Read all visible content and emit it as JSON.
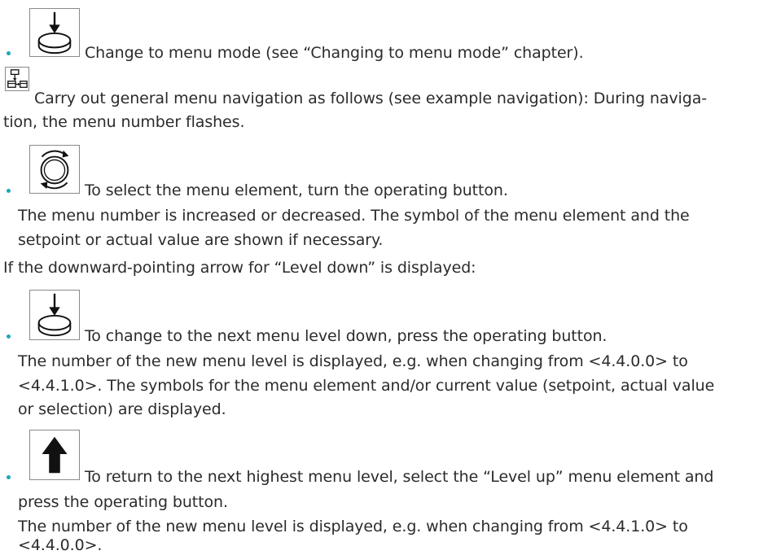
{
  "items": [
    {
      "icon": "press-button-icon",
      "bulleted": true,
      "lines": [
        "Change to menu mode (see “Changing to menu mode” chapter)."
      ]
    },
    {
      "icon": "menu-navigation-icon",
      "bulleted": false,
      "lines": [
        "Carry out general menu navigation as follows (see example navigation): During naviga-",
        "tion, the menu number flashes."
      ]
    },
    {
      "icon": "turn-button-icon",
      "bulleted": true,
      "lines": [
        "To select the menu element, turn the operating button.",
        "The menu number is increased or decreased. The symbol of the menu element and the",
        "setpoint or actual value are shown if necessary."
      ]
    },
    {
      "icon": null,
      "bulleted": false,
      "lines": [
        "If the downward-pointing arrow for “Level down” is displayed:"
      ]
    },
    {
      "icon": "press-button-icon",
      "bulleted": true,
      "lines": [
        "To change to the next menu level down, press the operating button.",
        "The number of the new menu level is displayed, e.g. when changing from <4.4.0.0> to",
        "<4.4.1.0>. The symbols for the menu element and/or current value (setpoint, actual value",
        "or selection) are displayed."
      ]
    },
    {
      "icon": "level-up-arrow-icon",
      "bulleted": true,
      "lines": [
        "To return to the next highest menu level, select the “Level up” menu element and",
        "press the operating button.",
        "The number of the new menu level is displayed, e.g. when changing from <4.4.1.0> to",
        "<4.4.0.0>."
      ]
    }
  ],
  "colors": {
    "bullet": "#1aa9b8",
    "text": "#2b2b2b"
  }
}
